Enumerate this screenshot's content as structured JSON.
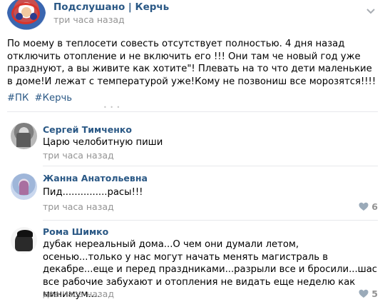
{
  "post": {
    "group_name": "Подслушано | Керчь",
    "time": "три часа назад",
    "text": "По моему в теплосети совесть отсутствует полностью. 4 дня назад отключить отопление и не включить его !!! Они там че новый год уже празднуют, а вы живите как хотите\"! Плевать на то что дети маленькие в доме!И лежат с температурой уже!Кому не позвониш все морозятся!!!!",
    "hashtags": [
      "#ПК",
      "#Керчь"
    ]
  },
  "comments": [
    {
      "author": "Сергей Тимченко",
      "text": "Царю челобитную пиши",
      "time": "три часа назад",
      "likes": ""
    },
    {
      "author": "Жанна Анатольевна",
      "text": "Пид...............расы!!!",
      "time": "три часа назад",
      "likes": "6"
    },
    {
      "author": "Рома Шимко",
      "text": "дубак нереальный дома...О чем они думали летом, осенью...только у нас могут начать менять магистраль в декабре...еще и перед праздниками...разрыли все и бросили...шас все рабочие забухают и отопления не видать еще неделю как минимум....",
      "time": "два часа назад",
      "likes": "5"
    }
  ],
  "icons": {
    "more": "chevron-down-icon",
    "like": "heart-icon"
  },
  "colors": {
    "link": "#2a5885",
    "meta": "#939393",
    "like": "#939393",
    "divider": "#e7e8ec"
  }
}
